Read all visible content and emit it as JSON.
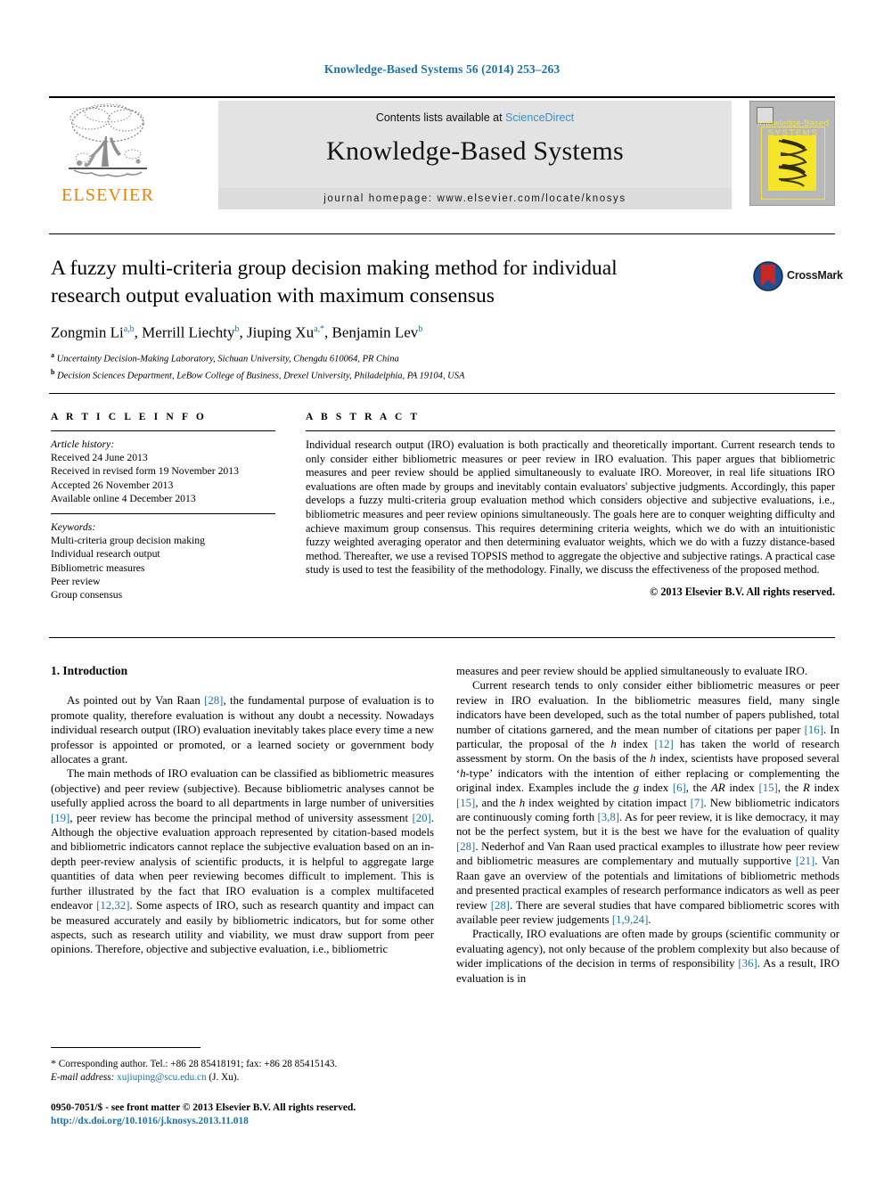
{
  "running_head": "Knowledge-Based Systems 56 (2014) 253–263",
  "masthead": {
    "publisher_name": "ELSEVIER",
    "contents_prefix": "Contents lists available at",
    "contents_link": "ScienceDirect",
    "journal_title": "Knowledge-Based Systems",
    "homepage": "journal homepage: www.elsevier.com/locate/knosys",
    "cover": {
      "line1": "Knowledge-Based",
      "line2": "SYSTEMS"
    },
    "colors": {
      "elsevier_orange": "#f08000",
      "link_blue": "#3a8fcc",
      "band_gray": "#e3e3e3",
      "cover_yellow": "#f5e42a",
      "cover_gray": "#b8b8b8"
    }
  },
  "article": {
    "title": "A fuzzy multi-criteria group decision making method for individual research output evaluation with maximum consensus",
    "authors": [
      {
        "name": "Zongmin Li",
        "sup": "a,b"
      },
      {
        "name": "Merrill Liechty",
        "sup": "b"
      },
      {
        "name": "Jiuping Xu",
        "sup": "a,*"
      },
      {
        "name": "Benjamin Lev",
        "sup": "b"
      }
    ],
    "affiliations": [
      {
        "marker": "a",
        "text": "Uncertainty Decision-Making Laboratory, Sichuan University, Chengdu 610064, PR China"
      },
      {
        "marker": "b",
        "text": "Decision Sciences Department, LeBow College of Business, Drexel University, Philadelphia, PA 19104, USA"
      }
    ],
    "crossmark_label": "CrossMark"
  },
  "article_info": {
    "heading": "A R T I C L E   I N F O",
    "history_label": "Article history:",
    "history": [
      "Received 24 June 2013",
      "Received in revised form 19 November 2013",
      "Accepted 26 November 2013",
      "Available online 4 December 2013"
    ],
    "keywords_label": "Keywords:",
    "keywords": [
      "Multi-criteria group decision making",
      "Individual research output",
      "Bibliometric measures",
      "Peer review",
      "Group consensus"
    ]
  },
  "abstract": {
    "heading": "A B S T R A C T",
    "body": "Individual research output (IRO) evaluation is both practically and theoretically important. Current research tends to only consider either bibliometric measures or peer review in IRO evaluation. This paper argues that bibliometric measures and peer review should be applied simultaneously to evaluate IRO. Moreover, in real life situations IRO evaluations are often made by groups and inevitably contain evaluators' subjective judgments. Accordingly, this paper develops a fuzzy multi-criteria group evaluation method which considers objective and subjective evaluations, i.e., bibliometric measures and peer review opinions simultaneously. The goals here are to conquer weighting difficulty and achieve maximum group consensus. This requires determining criteria weights, which we do with an intuitionistic fuzzy weighted averaging operator and then determining evaluator weights, which we do with a fuzzy distance-based method. Thereafter, we use a revised TOPSIS method to aggregate the objective and subjective ratings. A practical case study is used to test the feasibility of the methodology. Finally, we discuss the effectiveness of the proposed method.",
    "copyright": "© 2013 Elsevier B.V. All rights reserved."
  },
  "body": {
    "section_heading": "1. Introduction",
    "left_paragraphs": [
      "As pointed out by Van Raan [28], the fundamental purpose of evaluation is to promote quality, therefore evaluation is without any doubt a necessity. Nowadays individual research output (IRO) evaluation inevitably takes place every time a new professor is appointed or promoted, or a learned society or government body allocates a grant.",
      "The main methods of IRO evaluation can be classified as bibliometric measures (objective) and peer review (subjective). Because bibliometric analyses cannot be usefully applied across the board to all departments in large number of universities [19], peer review has become the principal method of university assessment [20]. Although the objective evaluation approach represented by citation-based models and bibliometric indicators cannot replace the subjective evaluation based on an in-depth peer-review analysis of scientific products, it is helpful to aggregate large quantities of data when peer reviewing becomes difficult to implement. This is further illustrated by the fact that IRO evaluation is a complex multifaceted endeavor [12,32]. Some aspects of IRO, such as research quantity and impact can be measured accurately and easily by bibliometric indicators, but for some other aspects, such as research utility and viability, we must draw support from peer opinions. Therefore, objective and subjective evaluation, i.e., bibliometric"
    ],
    "right_paragraphs": [
      "measures and peer review should be applied simultaneously to evaluate IRO.",
      "Current research tends to only consider either bibliometric measures or peer review in IRO evaluation. In the bibliometric measures field, many single indicators have been developed, such as the total number of papers published, total number of citations garnered, and the mean number of citations per paper [16]. In particular, the proposal of the h index [12] has taken the world of research assessment by storm. On the basis of the h index, scientists have proposed several 'h-type' indicators with the intention of either replacing or complementing the original index. Examples include the g index [6], the AR index [15], the R index [15], and the h index weighted by citation impact [7]. New bibliometric indicators are continuously coming forth [3,8]. As for peer review, it is like democracy, it may not be the perfect system, but it is the best we have for the evaluation of quality [28]. Nederhof and Van Raan used practical examples to illustrate how peer review and bibliometric measures are complementary and mutually supportive [21]. Van Raan gave an overview of the potentials and limitations of bibliometric methods and presented practical examples of research performance indicators as well as peer review [28]. There are several studies that have compared bibliometric scores with available peer review judgements [1,9,24].",
      "Practically, IRO evaluations are often made by groups (scientific community or evaluating agency), not only because of the problem complexity but also because of wider implications of the decision in terms of responsibility [36]. As a result, IRO evaluation is in"
    ]
  },
  "footnote": {
    "corresponding": "Corresponding author. Tel.: +86 28 85418191; fax: +86 28 85415143.",
    "email_label": "E-mail address:",
    "email": "xujiuping@scu.edu.cn",
    "email_suffix": "(J. Xu)."
  },
  "imprint": {
    "line1": "0950-7051/$ - see front matter © 2013 Elsevier B.V. All rights reserved.",
    "doi": "http://dx.doi.org/10.1016/j.knosys.2013.11.018"
  }
}
